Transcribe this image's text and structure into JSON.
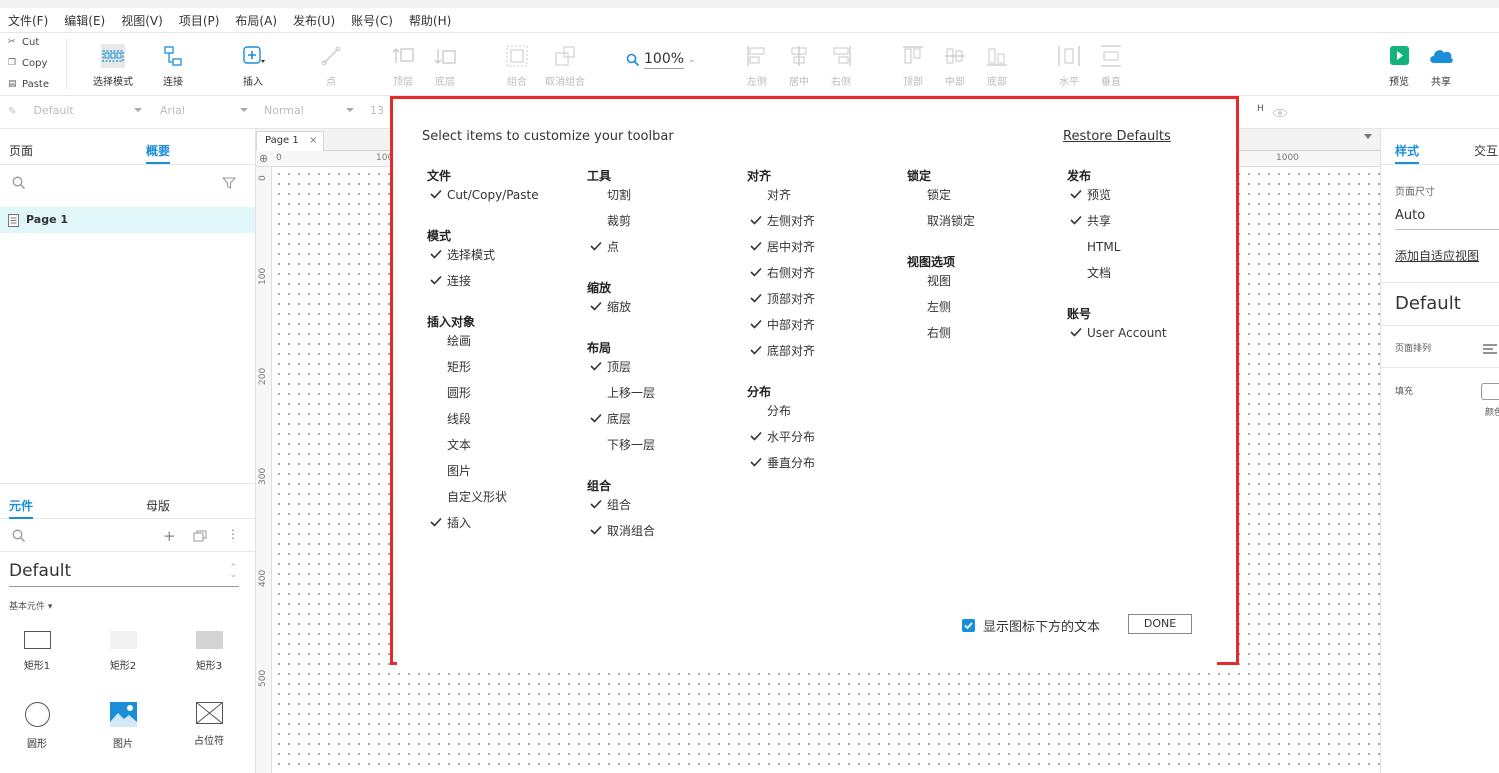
{
  "menu": [
    "文件(F)",
    "编辑(E)",
    "视图(V)",
    "项目(P)",
    "布局(A)",
    "发布(U)",
    "账号(C)",
    "帮助(H)"
  ],
  "clipboard": {
    "cut": "Cut",
    "copy": "Copy",
    "paste": "Paste"
  },
  "toolbar": {
    "select_mode": "选择模式",
    "connect": "连接",
    "insert": "插入",
    "point": "点",
    "top_layer": "顶层",
    "bottom_layer": "底层",
    "group": "组合",
    "ungroup": "取消组合",
    "zoom": "100%",
    "left": "左侧",
    "center": "居中",
    "right": "右侧",
    "top": "顶部",
    "middle": "中部",
    "bottom": "底部",
    "horizontal": "水平",
    "vertical": "垂直",
    "preview": "预览",
    "share": "共享"
  },
  "format": {
    "style": "Default",
    "font": "Arial",
    "weight": "Normal",
    "size": "13",
    "h_label": "H"
  },
  "left_panel": {
    "tabs": [
      "页面",
      "概要"
    ],
    "active_tab": "概要",
    "page_item": "Page 1",
    "lib_tabs": [
      "元件",
      "母版"
    ],
    "active_lib_tab": "元件",
    "library_name": "Default",
    "library_section": "基本元件 ▾",
    "widgets": [
      "矩形1",
      "矩形2",
      "矩形3",
      "圆形",
      "图片",
      "占位符"
    ]
  },
  "canvas": {
    "page_tab": "Page 1",
    "h_ruler": [
      "0",
      "100",
      "1000"
    ],
    "v_ruler": [
      "0",
      "100",
      "200",
      "300",
      "400",
      "500"
    ]
  },
  "right_panel": {
    "tabs": [
      "样式",
      "交互"
    ],
    "page_size_label": "页面尺寸",
    "page_size_value": "Auto",
    "adaptive_link": "添加自适应视图",
    "style_name": "Default",
    "page_arrange_label": "页面排列",
    "fill_label": "填充",
    "color_label": "颜色"
  },
  "dialog": {
    "title": "Select items to customize your toolbar",
    "restore": "Restore Defaults",
    "show_text_label": "显示图标下方的文本",
    "show_text_checked": true,
    "done": "DONE",
    "columns": [
      {
        "groups": [
          {
            "name": "文件",
            "items": [
              {
                "label": "Cut/Copy/Paste",
                "checked": true
              }
            ]
          },
          {
            "name": "模式",
            "items": [
              {
                "label": "选择模式",
                "checked": true
              },
              {
                "label": "连接",
                "checked": true
              }
            ]
          },
          {
            "name": "插入对象",
            "items": [
              {
                "label": "绘画",
                "checked": false
              },
              {
                "label": "矩形",
                "checked": false
              },
              {
                "label": "圆形",
                "checked": false
              },
              {
                "label": "线段",
                "checked": false
              },
              {
                "label": "文本",
                "checked": false
              },
              {
                "label": "图片",
                "checked": false
              },
              {
                "label": "自定义形状",
                "checked": false
              },
              {
                "label": "插入",
                "checked": true
              }
            ]
          }
        ]
      },
      {
        "groups": [
          {
            "name": "工具",
            "items": [
              {
                "label": "切割",
                "checked": false
              },
              {
                "label": "裁剪",
                "checked": false
              },
              {
                "label": "点",
                "checked": true
              }
            ]
          },
          {
            "name": "缩放",
            "items": [
              {
                "label": "缩放",
                "checked": true
              }
            ]
          },
          {
            "name": "布局",
            "items": [
              {
                "label": "顶层",
                "checked": true
              },
              {
                "label": "上移一层",
                "checked": false
              },
              {
                "label": "底层",
                "checked": true
              },
              {
                "label": "下移一层",
                "checked": false
              }
            ]
          },
          {
            "name": "组合",
            "items": [
              {
                "label": "组合",
                "checked": true
              },
              {
                "label": "取消组合",
                "checked": true
              }
            ]
          }
        ]
      },
      {
        "groups": [
          {
            "name": "对齐",
            "items": [
              {
                "label": "对齐",
                "checked": false
              },
              {
                "label": "左侧对齐",
                "checked": true
              },
              {
                "label": "居中对齐",
                "checked": true
              },
              {
                "label": "右侧对齐",
                "checked": true
              },
              {
                "label": "顶部对齐",
                "checked": true
              },
              {
                "label": "中部对齐",
                "checked": true
              },
              {
                "label": "底部对齐",
                "checked": true
              }
            ]
          },
          {
            "name": "分布",
            "items": [
              {
                "label": "分布",
                "checked": false
              },
              {
                "label": "水平分布",
                "checked": true
              },
              {
                "label": "垂直分布",
                "checked": true
              }
            ]
          }
        ]
      },
      {
        "groups": [
          {
            "name": "锁定",
            "items": [
              {
                "label": "锁定",
                "checked": false
              },
              {
                "label": "取消锁定",
                "checked": false
              }
            ]
          },
          {
            "name": "视图选项",
            "items": [
              {
                "label": "视图",
                "checked": false
              },
              {
                "label": "左侧",
                "checked": false
              },
              {
                "label": "右侧",
                "checked": false
              }
            ]
          }
        ]
      },
      {
        "groups": [
          {
            "name": "发布",
            "items": [
              {
                "label": "预览",
                "checked": true
              },
              {
                "label": "共享",
                "checked": true
              },
              {
                "label": "HTML",
                "checked": false
              },
              {
                "label": "文档",
                "checked": false
              }
            ]
          },
          {
            "name": "账号",
            "items": [
              {
                "label": "User Account",
                "checked": true
              }
            ]
          }
        ]
      }
    ]
  }
}
